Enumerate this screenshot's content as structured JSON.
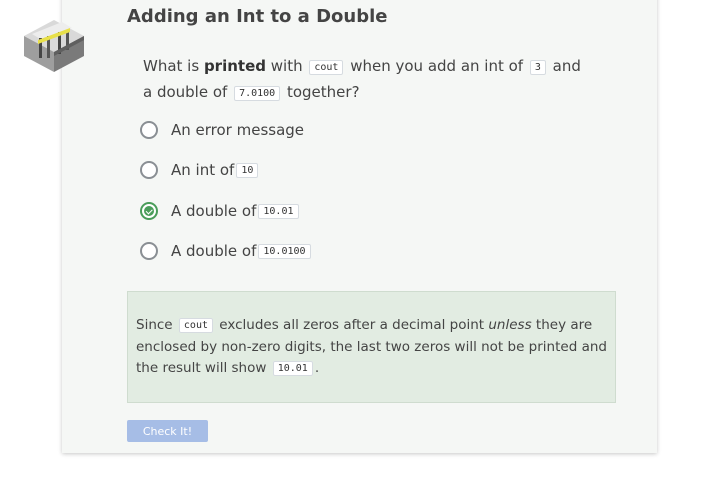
{
  "title": "Adding an Int to a Double",
  "question": {
    "p1": "What is ",
    "bold": "printed",
    "p2": " with ",
    "code1": "cout",
    "p3": " when you add an int of ",
    "code2": "3",
    "p4": " and a double of ",
    "code3": "7.0100",
    "p5": " together?"
  },
  "options": [
    {
      "text": "An error message",
      "code": "",
      "selected": false
    },
    {
      "text": "An int of ",
      "code": "10",
      "selected": false
    },
    {
      "text": "A double of ",
      "code": "10.01",
      "selected": true
    },
    {
      "text": "A double of ",
      "code": "10.0100",
      "selected": false
    }
  ],
  "feedback": {
    "p1": "Since ",
    "code1": "cout",
    "p2": " excludes all zeros after a decimal point ",
    "em": "unless",
    "p3": " they are enclosed by non-zero digits, the last two zeros will not be printed and the result will show ",
    "code2": "10.01",
    "p4": "."
  },
  "check_button": "Check It!",
  "colors": {
    "accent_green": "#4a9d5a",
    "feedback_bg": "#e2ece2",
    "button_bg": "#a6bde6"
  }
}
